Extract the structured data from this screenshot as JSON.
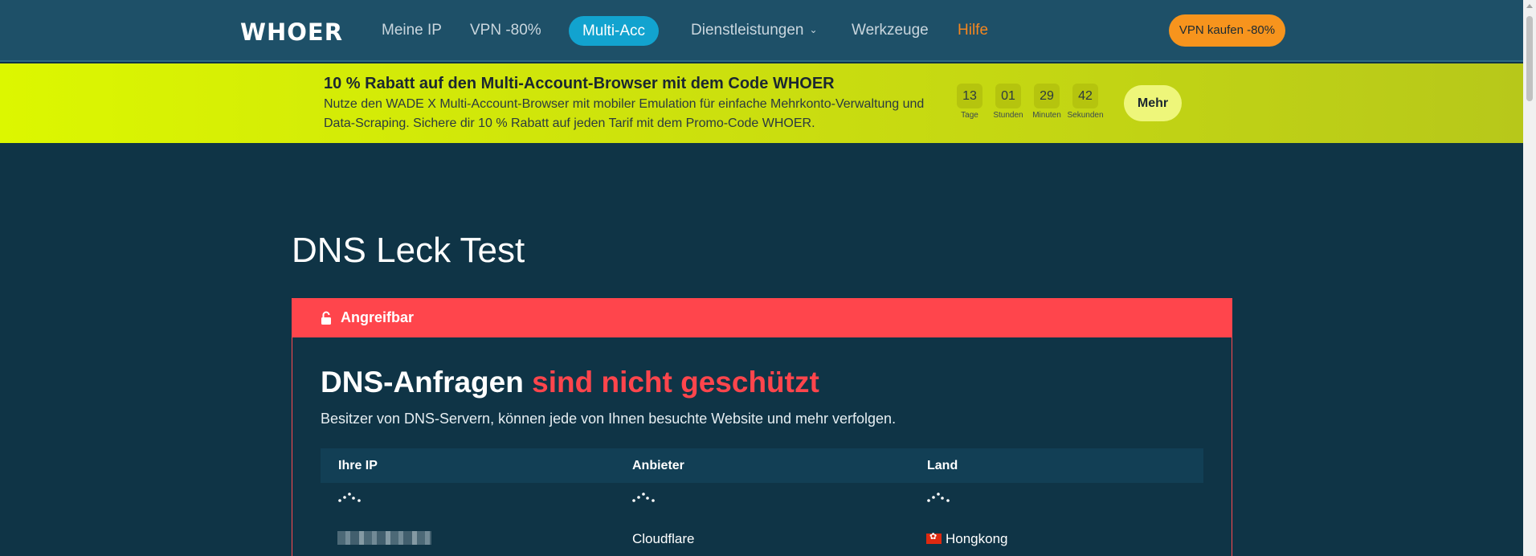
{
  "header": {
    "logo": "WHOER",
    "nav": {
      "meine_ip": "Meine IP",
      "vpn": "VPN -80%",
      "multi_acc": "Multi-Acc",
      "dienstleistungen": "Dienstleistungen",
      "werkzeuge": "Werkzeuge",
      "hilfe": "Hilfe"
    },
    "buy_button": "VPN kaufen -80%"
  },
  "promo": {
    "title": "10 % Rabatt auf den Multi-Account-Browser mit dem Code WHOER",
    "text": "Nutze den WADE X Multi-Account-Browser mit mobiler Emulation für einfache Mehrkonto-Verwaltung und Data-Scraping. Sichere dir 10 % Rabatt auf jeden Tarif mit dem Promo-Code WHOER.",
    "countdown": [
      {
        "value": "13",
        "label": "Tage"
      },
      {
        "value": "01",
        "label": "Stunden"
      },
      {
        "value": "29",
        "label": "Minuten"
      },
      {
        "value": "42",
        "label": "Sekunden"
      }
    ],
    "more_button": "Mehr"
  },
  "main": {
    "page_title": "DNS Leck Test",
    "status_label": "Angreifbar",
    "heading_part1": "DNS-Anfragen",
    "heading_part2": "sind nicht geschützt",
    "description": "Besitzer von DNS-Servern, können jede von Ihnen besuchte Website und mehr verfolgen.",
    "table": {
      "headers": [
        "Ihre IP",
        "Anbieter",
        "Land"
      ],
      "rows": [
        {
          "provider": "Cloudflare",
          "country": "Hongkong"
        }
      ]
    }
  },
  "colors": {
    "background": "#0f3446",
    "header": "#1e5068",
    "accent_blue": "#12a3cf",
    "accent_orange": "#f7941d",
    "promo": "#dcf700",
    "danger": "#ff454c"
  },
  "icons": [
    "unlock-icon",
    "chevron-down-icon",
    "loading-spinner-icon",
    "hongkong-flag-icon"
  ]
}
